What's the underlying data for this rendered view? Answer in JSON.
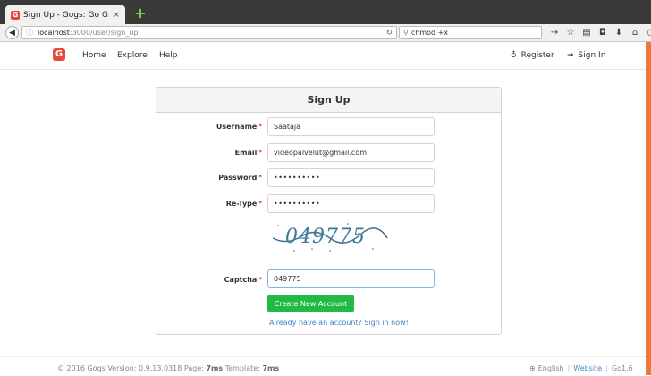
{
  "browser": {
    "tab_title": "Sign Up - Gogs: Go G...",
    "tab_close": "×",
    "new_tab": "+",
    "url_host": "localhost",
    "url_path": ":3000/user/sign_up",
    "search_value": "chmod +x"
  },
  "nav": {
    "home": "Home",
    "explore": "Explore",
    "help": "Help",
    "register": "Register",
    "signin": "Sign In"
  },
  "form": {
    "title": "Sign Up",
    "username_label": "Username",
    "username_value": "Saataja",
    "email_label": "Email",
    "email_value": "videopalvelut@gmail.com",
    "password_label": "Password",
    "password_value": "••••••••••",
    "retype_label": "Re-Type",
    "retype_value": "••••••••••",
    "captcha_image_text": "049775",
    "captcha_label": "Captcha",
    "captcha_value": "049775",
    "create_button": "Create New Account",
    "signin_link": "Already have an account? Sign in now!",
    "required_mark": "*"
  },
  "footer": {
    "version_prefix": "© 2016 Gogs Version: 0.9.13.0318 Page: ",
    "page_time": "7ms",
    "template_prefix": " Template: ",
    "template_time": "7ms",
    "language": "English",
    "website": "Website",
    "go_version": "Go1.6"
  },
  "colors": {
    "accent_green": "#21ba45",
    "link_blue": "#4183c4",
    "required_red": "#db2828",
    "logo_red": "#e34c3b"
  }
}
